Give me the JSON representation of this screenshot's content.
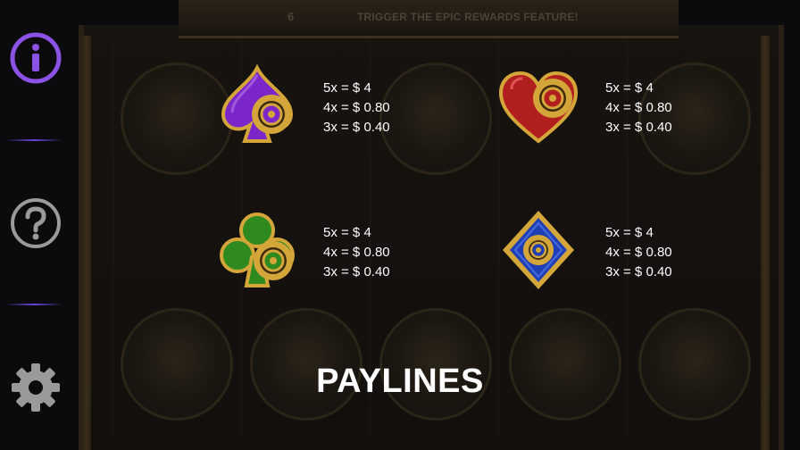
{
  "background": {
    "top_counter": "6",
    "top_banner": "TRIGGER THE EPIC REWARDS FEATURE!"
  },
  "sidebar": {
    "info_icon": "info-icon",
    "help_icon": "help-icon",
    "settings_icon": "gear-icon",
    "accent_color": "#8b52e6",
    "divider_color": "#6a45d8"
  },
  "paytable": {
    "symbols": [
      {
        "name": "purple-spade",
        "color": "#7a26c9",
        "lines": [
          "5x = $ 4",
          "4x = $ 0.80",
          "3x = $ 0.40"
        ]
      },
      {
        "name": "red-heart",
        "color": "#b11e1e",
        "lines": [
          "5x = $ 4",
          "4x = $ 0.80",
          "3x = $ 0.40"
        ]
      },
      {
        "name": "green-club",
        "color": "#2e8a1f",
        "lines": [
          "5x = $ 4",
          "4x = $ 0.80",
          "3x = $ 0.40"
        ]
      },
      {
        "name": "blue-diamond",
        "color": "#1f3fb5",
        "lines": [
          "5x = $ 4",
          "4x = $ 0.80",
          "3x = $ 0.40"
        ]
      }
    ],
    "gold_color": "#d4a63a"
  },
  "section_heading": "PAYLINES"
}
